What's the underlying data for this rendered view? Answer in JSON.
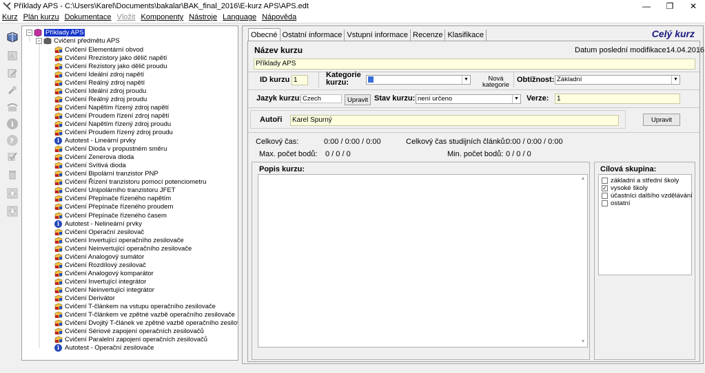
{
  "window": {
    "title": "Příklady APS - C:\\Users\\Karel\\Documents\\bakalar\\BAK_final_2016\\E-kurz APS\\APS.edt",
    "controls": {
      "minimize": "—",
      "restore": "❐",
      "close": "✕"
    }
  },
  "menu": [
    {
      "label": "Kurz",
      "enabled": true
    },
    {
      "label": "Plán kurzu",
      "enabled": true
    },
    {
      "label": "Dokumentace",
      "enabled": true
    },
    {
      "label": "Vložit",
      "enabled": false
    },
    {
      "label": "Komponenty",
      "enabled": true
    },
    {
      "label": "Nástroje",
      "enabled": true
    },
    {
      "label": "Language",
      "enabled": true
    },
    {
      "label": "Nápověda",
      "enabled": true
    }
  ],
  "toolbar_icons": [
    "book-icon",
    "text-icon",
    "edit-icon",
    "tools-icon",
    "phone-icon",
    "info-icon",
    "help-icon",
    "check-icon",
    "delete-icon",
    "move-up-icon",
    "move-down-icon"
  ],
  "tree": {
    "root": {
      "label": "Příklady APS",
      "expander": "−"
    },
    "group": {
      "label": "Cvičení předmětu APS",
      "expander": "−"
    },
    "items": [
      {
        "label": "Cvičení Elementární obvod",
        "type": "exercise"
      },
      {
        "label": "Cvičení Rrezistory jako dělič napětí",
        "type": "exercise"
      },
      {
        "label": "Cvičení Rezistory jako dělič proudu",
        "type": "exercise"
      },
      {
        "label": "Cvičení Ideální zdroj napětí",
        "type": "exercise"
      },
      {
        "label": "Cvičení Reálný zdroj napětí",
        "type": "exercise"
      },
      {
        "label": "Cvičení Ideální zdroj proudu",
        "type": "exercise"
      },
      {
        "label": "Cvičení Reálný zdroj proudu",
        "type": "exercise"
      },
      {
        "label": "Cvičení Napětím řízený zdroj napětí",
        "type": "exercise"
      },
      {
        "label": "Cvičení Proudem řízení zdroj napětí",
        "type": "exercise"
      },
      {
        "label": "Cvičení Napětím řízený zdroj proudu",
        "type": "exercise"
      },
      {
        "label": "Cvičení Proudem řízený zdroj proudu",
        "type": "exercise"
      },
      {
        "label": "Autotest - Lineární prvky",
        "type": "test"
      },
      {
        "label": "Cvičení Dioda v propustném směru",
        "type": "exercise"
      },
      {
        "label": "Cvičení Zenerova dioda",
        "type": "exercise"
      },
      {
        "label": "Cvičení Svítivá dioda",
        "type": "exercise"
      },
      {
        "label": "Cvičení Bipolární tranzistor PNP",
        "type": "exercise"
      },
      {
        "label": "Cvičení Řízení tranzistoru pomocí potenciometru",
        "type": "exercise"
      },
      {
        "label": "Cvičení Unipolárního tranzistoru JFET",
        "type": "exercise"
      },
      {
        "label": "Cvičení Přepínače řízeného napětím",
        "type": "exercise"
      },
      {
        "label": "Cvičení Přepínače řízeného proudem",
        "type": "exercise"
      },
      {
        "label": "Cvičení Přepínače řízeného časem",
        "type": "exercise"
      },
      {
        "label": "Autotest - Nelineární prvky",
        "type": "test"
      },
      {
        "label": "Cvičení Operační zesilovač",
        "type": "exercise"
      },
      {
        "label": "Cvičení Invertující operačního zesilovače",
        "type": "exercise"
      },
      {
        "label": "Cvičení Neinvertující operačního zesilovače",
        "type": "exercise"
      },
      {
        "label": "Cvičení Analogový sumátor",
        "type": "exercise"
      },
      {
        "label": "Cvičení Rozdílový zesilovač",
        "type": "exercise"
      },
      {
        "label": "Cvičení Analogový komparátor",
        "type": "exercise"
      },
      {
        "label": "Cvičení Invertující integrátor",
        "type": "exercise"
      },
      {
        "label": "Cvičení Neinvertující integrátor",
        "type": "exercise"
      },
      {
        "label": "Cvičení Derivátor",
        "type": "exercise"
      },
      {
        "label": "Cvičení T-článkem na vstupu operačního zesilovače",
        "type": "exercise"
      },
      {
        "label": "Cvičení T-článkem ve zpětné vazbě operačního zesilovače",
        "type": "exercise"
      },
      {
        "label": "Cvičení Dvojitý T-článek ve zpětné vazbě operačního zesilovače",
        "type": "exercise"
      },
      {
        "label": "Cvičení Sériové zapojení operačních zesilovačů",
        "type": "exercise"
      },
      {
        "label": "Cvičení Paralelní zapojení operačních zesilovačů",
        "type": "exercise"
      },
      {
        "label": "Autotest - Operační zesilovače",
        "type": "test"
      }
    ]
  },
  "tabs": [
    {
      "label": "Obecné",
      "active": true
    },
    {
      "label": "Ostatní informace",
      "active": false
    },
    {
      "label": "Vstupní informace",
      "active": false
    },
    {
      "label": "Recenze",
      "active": false
    },
    {
      "label": "Klasifikace",
      "active": false
    }
  ],
  "course_scope": "Celý kurz",
  "form": {
    "course_name_label": "Název kurzu",
    "last_modified_label": "Datum poslední modifikace:",
    "last_modified_value": "14.04.2016",
    "course_name_value": "Příklady APS",
    "id_label": "ID kurzu",
    "id_value": "1",
    "category_label": "Kategorie kurzu:",
    "category_value": "",
    "new_category_label": "Nová kategorie",
    "difficulty_label": "Obtížnost:",
    "difficulty_value": "Základní",
    "language_label": "Jazyk kurzu:",
    "language_value": "Czech",
    "language_edit_label": "Upravit",
    "status_label": "Stav kurzu:",
    "status_value": "není určeno",
    "version_label": "Verze:",
    "version_value": "1",
    "authors_label": "Autoři",
    "authors_value": "Karel Spurný",
    "authors_edit_label": "Upravit",
    "total_time_label": "Celkový čas:",
    "total_time_value": "0:00 / 0:00 / 0:00",
    "articles_time_label": "Celkový čas studijních článků:",
    "articles_time_value": "0:00 / 0:00 / 0:00",
    "max_points_label": "Max. počet bodů:",
    "max_points_value": "0 / 0 / 0",
    "min_points_label": "Min. počet bodů:",
    "min_points_value": "0 / 0 / 0",
    "description_label": "Popis kurzu:",
    "description_value": "",
    "target_group_label": "Cílová skupina:",
    "target_groups": [
      {
        "label": "základní a střední školy",
        "checked": false
      },
      {
        "label": "vysoké školy",
        "checked": true
      },
      {
        "label": "účastníci dalšího vzdělávání",
        "checked": false
      },
      {
        "label": "ostatní",
        "checked": false
      }
    ]
  },
  "colors": {
    "selection": "#1434c8",
    "field_bg": "#ffffe0",
    "scope_text": "#1a1a80"
  }
}
